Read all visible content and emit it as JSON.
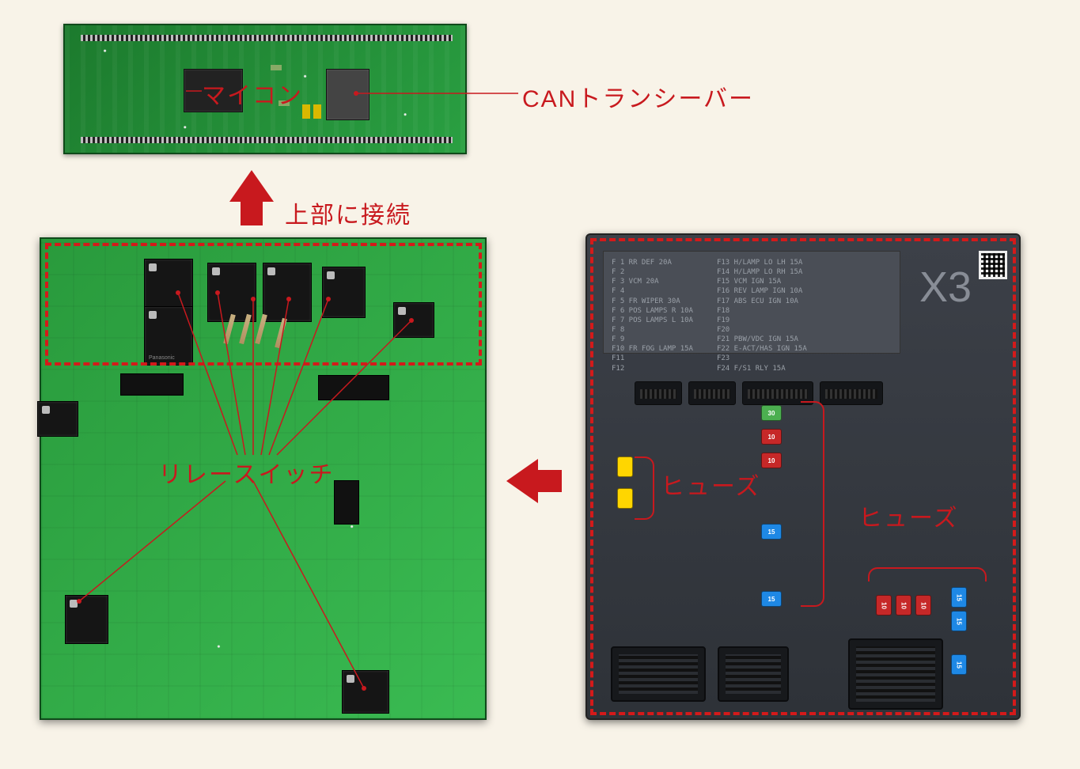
{
  "labels": {
    "mcu": "マイコン",
    "can": "CANトランシーバー",
    "connect_top": "上部に接続",
    "relay": "リレースイッチ",
    "fuse_left": "ヒューズ",
    "fuse_right": "ヒューズ"
  },
  "fusebox": {
    "model": "X3",
    "left_col": [
      "F 1  RR DEF       20A",
      "F 2",
      "F 3  VCM          20A",
      "F 4",
      "F 5  FR WIPER     30A",
      "F 6  POS LAMPS R  10A",
      "F 7  POS LAMPS L  10A",
      "F 8",
      "F 9",
      "F10  FR FOG LAMP  15A",
      "F11",
      "F12"
    ],
    "right_col": [
      "F13  H/LAMP LO LH 15A",
      "F14  H/LAMP LO RH 15A",
      "F15  VCM IGN      15A",
      "F16  REV LAMP IGN 10A",
      "F17  ABS ECU IGN  10A",
      "F18",
      "F19",
      "F20",
      "F21  PBW/VDC IGN  15A",
      "F22  E-ACT/HAS IGN 15A",
      "F23",
      "F24  F/S1 RLY     15A"
    ],
    "fuses_left_group": [
      {
        "c": "yellow",
        "v": ""
      },
      {
        "c": "yellow",
        "v": ""
      }
    ],
    "fuses_center_group": [
      {
        "c": "green",
        "v": "30"
      },
      {
        "c": "red",
        "v": "10"
      },
      {
        "c": "red",
        "v": "10"
      },
      {
        "c": "blue",
        "v": "15"
      },
      {
        "c": "blue",
        "v": "15"
      }
    ],
    "fuses_right_group": [
      {
        "c": "red",
        "v": "10"
      },
      {
        "c": "red",
        "v": "10"
      },
      {
        "c": "red",
        "v": "10"
      },
      {
        "c": "blue",
        "v": "15"
      },
      {
        "c": "blue",
        "v": "15"
      },
      {
        "c": "blue",
        "v": "15"
      }
    ]
  },
  "colors": {
    "accent": "#c8191e",
    "pcb": "#2aa042",
    "box": "#3c4048"
  }
}
